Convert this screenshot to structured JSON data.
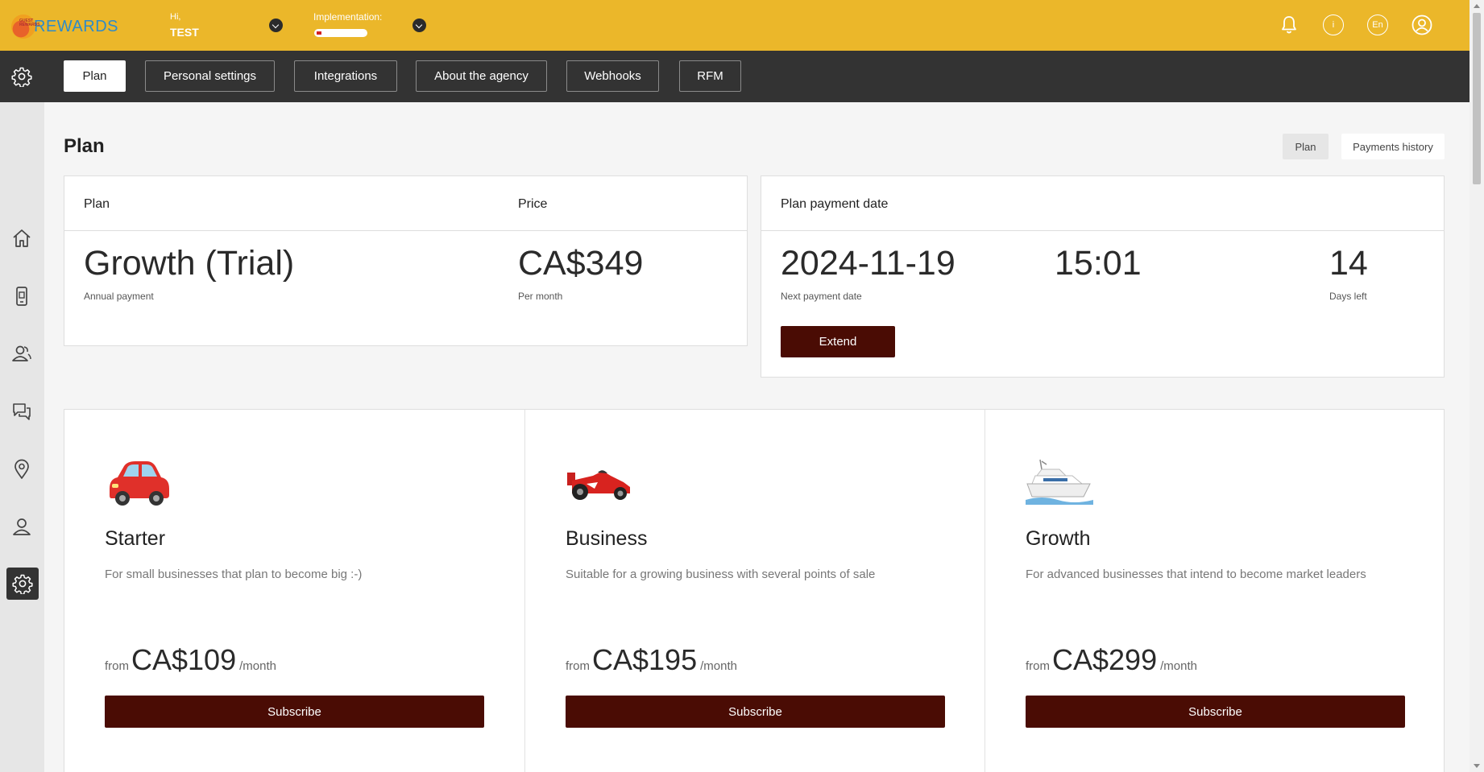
{
  "app": {
    "logo_text": "REWARDS",
    "logo_small": "GUEST REWARDS"
  },
  "topbar": {
    "greeting": "Hi,",
    "user_name": "TEST",
    "implementation_label": "Implementation:",
    "implementation_progress": 0.1,
    "language": "En",
    "icons": [
      "bell-icon",
      "info-icon",
      "language-icon",
      "user-icon"
    ],
    "background_color": "#ebb72a"
  },
  "navbar": {
    "tabs": [
      "Plan",
      "Personal settings",
      "Integrations",
      "About the agency",
      "Webhooks",
      "RFM"
    ],
    "active_tab": "Plan"
  },
  "sidebar": {
    "icons": [
      "home-icon",
      "mobile-card-icon",
      "customers-icon",
      "chat-icon",
      "location-icon",
      "user-icon",
      "settings-icon"
    ],
    "active": "settings-icon"
  },
  "page": {
    "title": "Plan",
    "tab_plan": "Plan",
    "tab_history": "Payments history"
  },
  "current_plan": {
    "plan_header": "Plan",
    "price_header": "Price",
    "plan_name": "Growth (Trial)",
    "plan_sub": "Annual payment",
    "price": "CA$349",
    "price_sub": "Per month"
  },
  "payment": {
    "header": "Plan payment date",
    "date": "2024-11-19",
    "date_sub": "Next payment date",
    "time": "15:01",
    "days": "14",
    "days_sub": "Days left",
    "extend_label": "Extend"
  },
  "plans": [
    {
      "icon": "car-icon",
      "name": "Starter",
      "description": "For small businesses that plan to become big :-)",
      "from": "from",
      "price": "CA$109",
      "per": "/month",
      "button": "Subscribe"
    },
    {
      "icon": "race-car-icon",
      "name": "Business",
      "description": "Suitable for a growing business with several points of sale",
      "from": "from",
      "price": "CA$195",
      "per": "/month",
      "button": "Subscribe"
    },
    {
      "icon": "yacht-icon",
      "name": "Growth",
      "description": "For advanced businesses that intend to become market leaders",
      "from": "from",
      "price": "CA$299",
      "per": "/month",
      "button": "Subscribe"
    }
  ],
  "colors": {
    "accent": "#ebb72a",
    "nav": "#333333",
    "button": "#4a0c04"
  }
}
